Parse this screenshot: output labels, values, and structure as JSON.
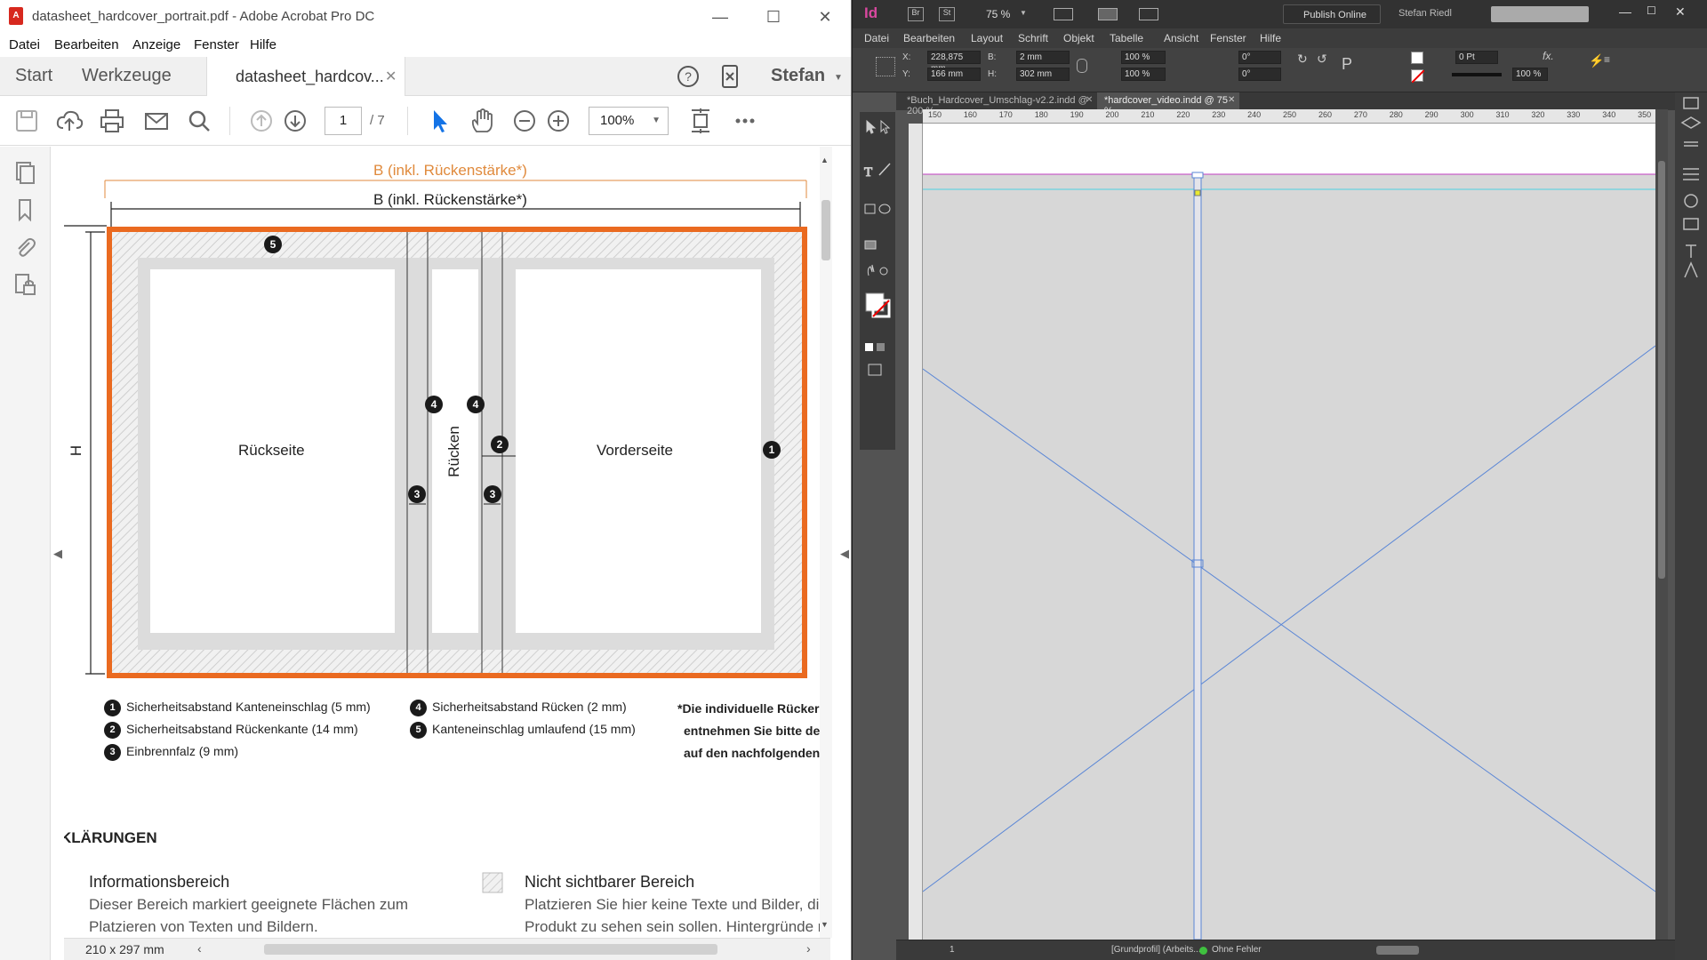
{
  "acrobat": {
    "window_title": "datasheet_hardcover_portrait.pdf - Adobe Acrobat Pro DC",
    "menu": [
      "Datei",
      "Bearbeiten",
      "Anzeige",
      "Fenster",
      "Hilfe"
    ],
    "tabs": {
      "start": "Start",
      "tools": "Werkzeuge",
      "doc": "datasheet_hardcov...",
      "user": "Stefan"
    },
    "toolbar": {
      "page_current": "1",
      "page_total": "/ 7",
      "zoom": "100%"
    },
    "status": {
      "page_size": "210 x 297 mm"
    },
    "diagram": {
      "label_width_outer": "B (inkl. Rückenstärke*)",
      "label_width_inner": "B (inkl. Rückenstärke*)",
      "label_height": "H",
      "label_back": "Rückseite",
      "label_spine": "Rücken",
      "label_front": "Vorderseite",
      "colors": {
        "bleed": "#ea6a20",
        "safe": "#d9d9d9",
        "dim_outer": "#e08a3c"
      }
    },
    "legend": [
      {
        "num": "1",
        "text": "Sicherheitsabstand Kanteneinschlag (5 mm)"
      },
      {
        "num": "2",
        "text": "Sicherheitsabstand Rückenkante (14 mm)"
      },
      {
        "num": "3",
        "text": "Einbrennfalz (9 mm)"
      },
      {
        "num": "4",
        "text": "Sicherheitsabstand Rücken (2 mm)"
      },
      {
        "num": "5",
        "text": "Kanteneinschlag umlaufend (15 mm)"
      }
    ],
    "note_lines": [
      "*Die individuelle Rücker",
      "entnehmen Sie bitte de",
      "auf den nachfolgenden"
    ],
    "section_heading": "KLÄRUNGEN",
    "info": {
      "title": "Informationsbereich",
      "line1": "Dieser Bereich markiert geeignete Flächen zum",
      "line2": "Platzieren von Texten und Bildern."
    },
    "invisible": {
      "title": "Nicht sichtbarer Bereich",
      "line1": "Platzieren Sie hier keine Texte und Bilder, die",
      "line2": "Produkt zu sehen sein sollen. Hintergründe r"
    }
  },
  "indesign": {
    "app_logo": "Id",
    "zoom": "75 %",
    "publish": "Publish Online",
    "user": "Stefan Riedl",
    "menu": [
      "Datei",
      "Bearbeiten",
      "Layout",
      "Schrift",
      "Objekt",
      "Tabelle",
      "Ansicht",
      "Fenster",
      "Hilfe"
    ],
    "control": {
      "x_label": "X:",
      "x": "228,875 mm",
      "y_label": "Y:",
      "y": "166 mm",
      "w_label": "B:",
      "w": "2 mm",
      "h_label": "H:",
      "h": "302 mm",
      "scale_x": "100 %",
      "scale_y": "100 %",
      "angle": "0°",
      "shear": "0°",
      "stroke": "0 Pt",
      "opacity": "100 %"
    },
    "doc_tabs": [
      "*Buch_Hardcover_Umschlag-v2.2.indd @ 200 %",
      "*hardcover_video.indd @ 75 %"
    ],
    "ruler_h": [
      "150",
      "160",
      "170",
      "180",
      "190",
      "200",
      "210",
      "220",
      "230",
      "240",
      "250",
      "260",
      "270",
      "280",
      "290",
      "300",
      "310",
      "320",
      "330",
      "340",
      "350"
    ],
    "status": {
      "page": "1",
      "profile": "[Grundprofil] (Arbeits...",
      "errors": "Ohne Fehler"
    }
  }
}
